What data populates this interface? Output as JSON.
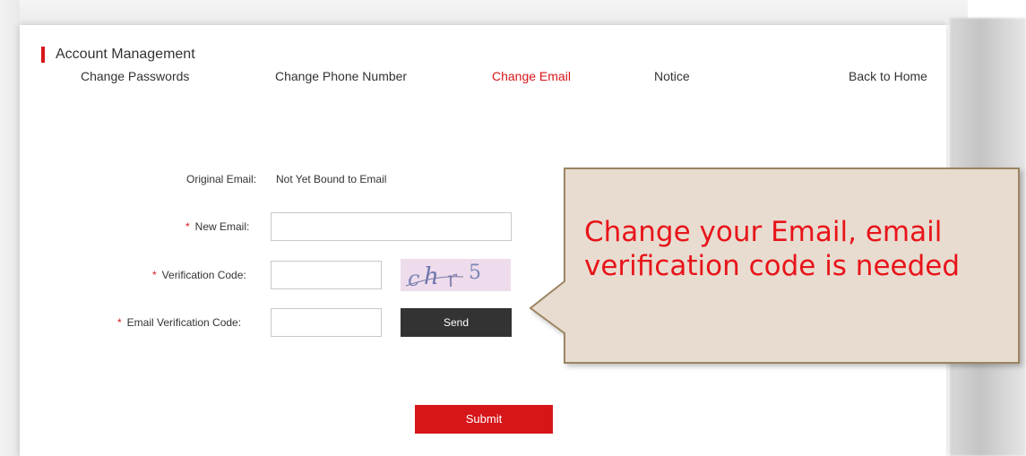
{
  "header": {
    "section_title": "Account Management"
  },
  "nav": {
    "items": [
      {
        "label": "Change Passwords",
        "active": false
      },
      {
        "label": "Change Phone Number",
        "active": false
      },
      {
        "label": "Change Email",
        "active": true
      },
      {
        "label": "Notice",
        "active": false
      }
    ],
    "back_home": "Back to Home"
  },
  "form": {
    "original_email_label": "Original Email:",
    "original_email_value": "Not Yet Bound to Email",
    "required_marker": "*",
    "new_email_label": "New Email:",
    "new_email_value": "",
    "verification_code_label": "Verification Code:",
    "verification_code_value": "",
    "captcha_text": "chr5",
    "email_code_label": "Email Verification Code:",
    "email_code_value": "",
    "send_label": "Send",
    "submit_label": "Submit"
  },
  "callout": {
    "text": "Change your Email, email verification code is needed",
    "fill": "#e8dcd0",
    "border": "#9c8462",
    "text_color": "#e8141a"
  },
  "colors": {
    "accent": "#d7161a",
    "dark_button": "#333333"
  }
}
